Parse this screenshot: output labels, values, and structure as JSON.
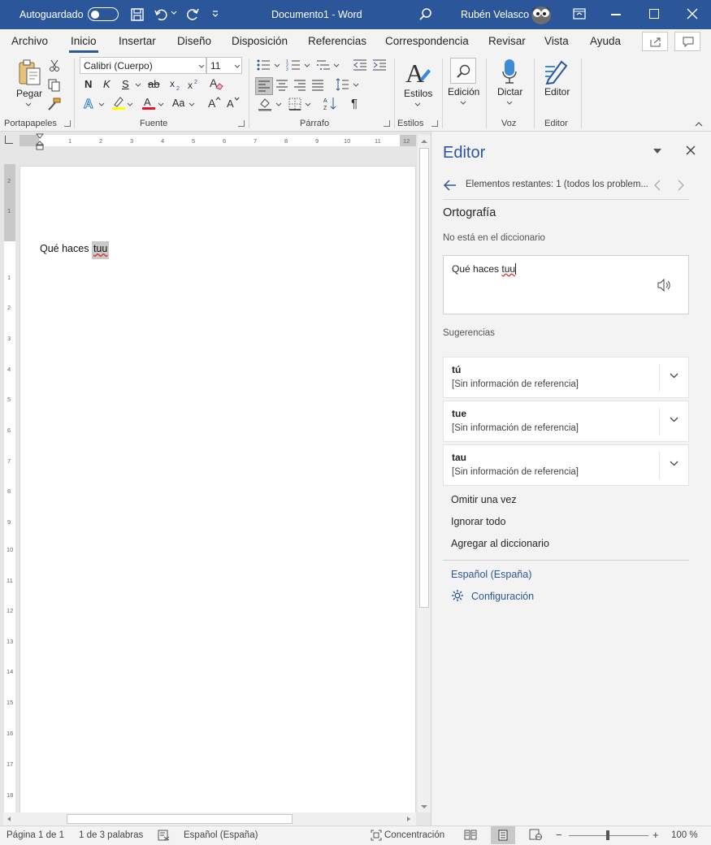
{
  "titlebar": {
    "autosave_label": "Autoguardado",
    "doc_title": "Documento1  -  Word",
    "user_name": "Rubén Velasco"
  },
  "menu": {
    "tabs": [
      "Archivo",
      "Inicio",
      "Insertar",
      "Diseño",
      "Disposición",
      "Referencias",
      "Correspondencia",
      "Revisar",
      "Vista",
      "Ayuda"
    ],
    "active_tab": "Inicio"
  },
  "ribbon": {
    "paste_label": "Pegar",
    "font_name": "Calibri (Cuerpo)",
    "font_size": "11",
    "bold_label": "N",
    "italic_label": "K",
    "underline_label": "S",
    "strike_label": "ab",
    "change_case_label": "Aa",
    "styles_label": "Estilos",
    "edit_label": "Edición",
    "dictate_label": "Dictar",
    "editor_label": "Editor",
    "groups": {
      "clipboard": "Portapapeles",
      "font": "Fuente",
      "paragraph": "Párrafo",
      "styles": "Estilos",
      "voice": "Voz",
      "editor": "Editor"
    },
    "accent_color": "#2b579a"
  },
  "document": {
    "text_before": "Qué haces ",
    "misspelled_word": "tuu"
  },
  "editor_pane": {
    "title": "Editor",
    "remaining": "Elementos restantes: 1 (todos los problem...",
    "section": "Ortografía",
    "reason": "No está en el diccionario",
    "context_before": "Qué haces ",
    "context_word": "tuu",
    "suggestions_label": "Sugerencias",
    "suggestions": [
      {
        "word": "tú",
        "ref": "[Sin información de referencia]"
      },
      {
        "word": "tue",
        "ref": "[Sin información de referencia]"
      },
      {
        "word": "tau",
        "ref": "[Sin información de referencia]"
      }
    ],
    "actions": [
      "Omitir una vez",
      "Ignorar todo",
      "Agregar al diccionario"
    ],
    "language": "Español (España)",
    "settings": "Configuración"
  },
  "statusbar": {
    "page": "Página 1 de 1",
    "words": "1 de 3 palabras",
    "language": "Español (España)",
    "focus": "Concentración",
    "zoom": "100 %",
    "zoom_minus": "−",
    "zoom_plus": "+"
  },
  "ruler": {
    "h_labels": [
      "1",
      "2",
      "3",
      "4",
      "5",
      "6",
      "7",
      "8",
      "9",
      "10",
      "11",
      "12"
    ],
    "v_labels": [
      "2",
      "1",
      "1",
      "2",
      "3",
      "4",
      "5",
      "6",
      "7",
      "8",
      "9",
      "10",
      "11",
      "12",
      "13",
      "14",
      "15",
      "16",
      "17",
      "18"
    ]
  }
}
